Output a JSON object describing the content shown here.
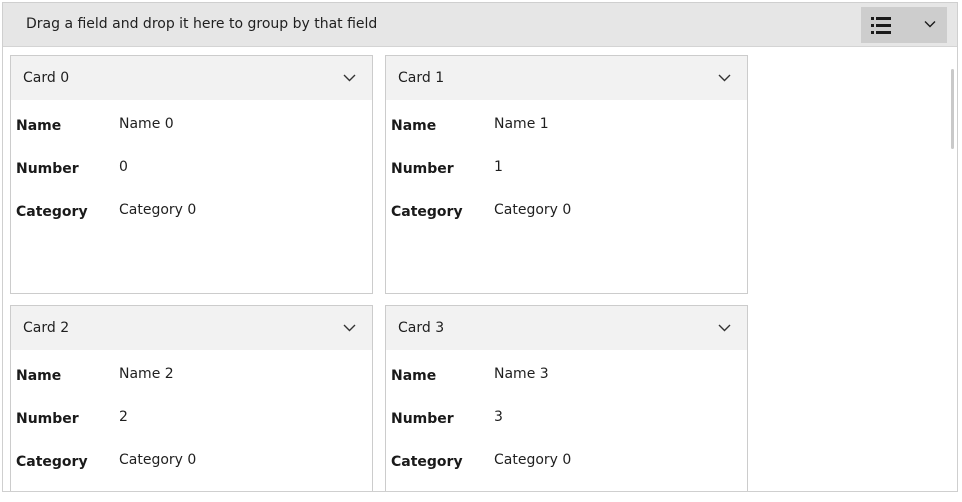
{
  "group_panel": {
    "text": "Drag a field and drop it here to group by that field"
  },
  "view_selector": {
    "icon": "list-view-icon",
    "dropdown_icon": "chevron-down-icon"
  },
  "cards": [
    {
      "title": "Card 0",
      "fields": [
        {
          "label": "Name",
          "value": "Name 0"
        },
        {
          "label": "Number",
          "value": "0"
        },
        {
          "label": "Category",
          "value": "Category 0"
        }
      ]
    },
    {
      "title": "Card 1",
      "fields": [
        {
          "label": "Name",
          "value": "Name 1"
        },
        {
          "label": "Number",
          "value": "1"
        },
        {
          "label": "Category",
          "value": "Category 0"
        }
      ]
    },
    {
      "title": "Card 2",
      "fields": [
        {
          "label": "Name",
          "value": "Name 2"
        },
        {
          "label": "Number",
          "value": "2"
        },
        {
          "label": "Category",
          "value": "Category 0"
        }
      ]
    },
    {
      "title": "Card 3",
      "fields": [
        {
          "label": "Name",
          "value": "Name 3"
        },
        {
          "label": "Number",
          "value": "3"
        },
        {
          "label": "Category",
          "value": "Category 0"
        }
      ]
    }
  ]
}
